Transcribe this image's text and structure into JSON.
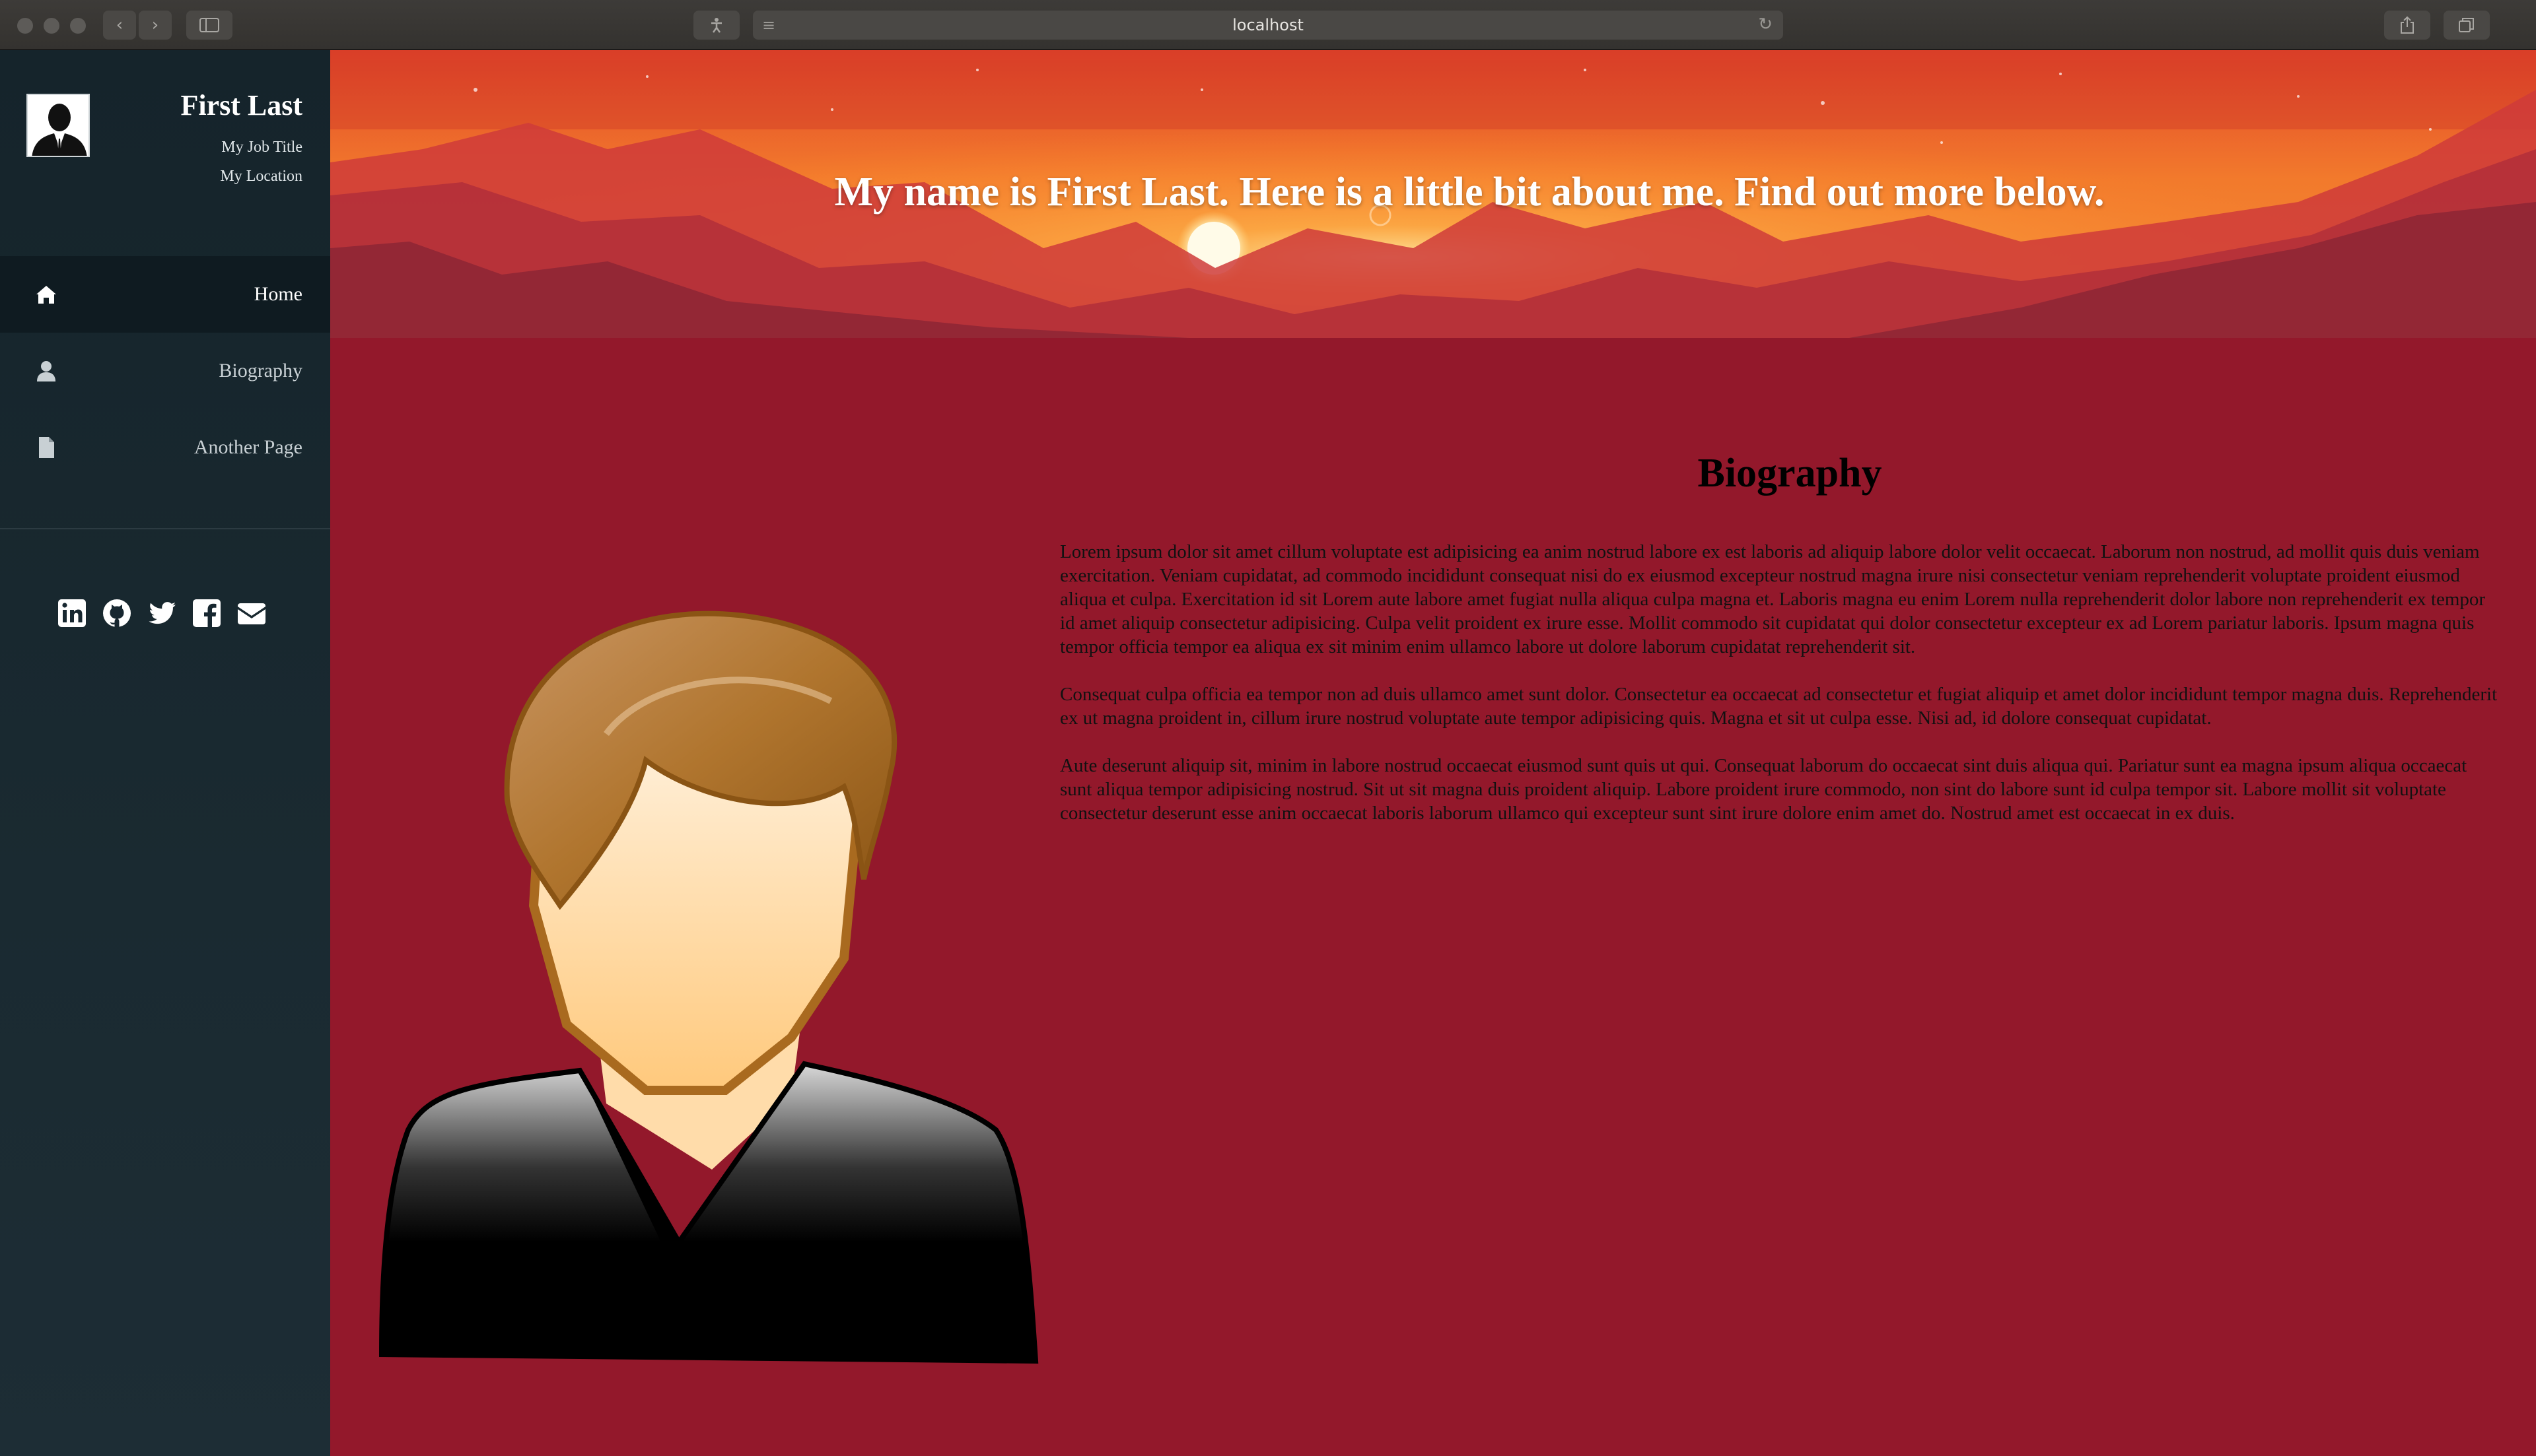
{
  "browser": {
    "url": "localhost"
  },
  "profile": {
    "name": "First Last",
    "job_title": "My Job Title",
    "location": "My Location"
  },
  "nav": {
    "items": [
      {
        "label": "Home",
        "icon": "home-icon",
        "active": true
      },
      {
        "label": "Biography",
        "icon": "user-icon",
        "active": false
      },
      {
        "label": "Another Page",
        "icon": "file-icon",
        "active": false
      }
    ]
  },
  "social": [
    "linkedin-icon",
    "github-icon",
    "twitter-icon",
    "facebook-icon",
    "envelope-icon"
  ],
  "hero": {
    "title": "My name is First Last. Here is a little bit about me. Find out more below."
  },
  "bio": {
    "heading": "Biography",
    "paragraphs": [
      "Lorem ipsum dolor sit amet cillum voluptate est adipisicing ea anim nostrud labore ex est laboris ad aliquip labore dolor velit occaecat. Laborum non nostrud, ad mollit quis duis veniam exercitation. Veniam cupidatat, ad commodo incididunt consequat nisi do ex eiusmod excepteur nostrud magna irure nisi consectetur veniam reprehenderit voluptate proident eiusmod aliqua et culpa. Exercitation id sit Lorem aute labore amet fugiat nulla aliqua culpa magna et. Laboris magna eu enim Lorem nulla reprehenderit dolor labore non reprehenderit ex tempor id amet aliquip consectetur adipisicing. Culpa velit proident ex irure esse. Mollit commodo sit cupidatat qui dolor consectetur excepteur ex ad Lorem pariatur laboris. Ipsum magna quis tempor officia tempor ea aliqua ex sit minim enim ullamco labore ut dolore laborum cupidatat reprehenderit sit.",
      "Consequat culpa officia ea tempor non ad duis ullamco amet sunt dolor. Consectetur ea occaecat ad consectetur et fugiat aliquip et amet dolor incididunt tempor magna duis. Reprehenderit ex ut magna proident in, cillum irure nostrud voluptate aute tempor adipisicing quis. Magna et sit ut culpa esse. Nisi ad, id dolore consequat cupidatat.",
      "Aute deserunt aliquip sit, minim in labore nostrud occaecat eiusmod sunt quis ut qui. Consequat laborum do occaecat sint duis aliqua qui. Pariatur sunt ea magna ipsum aliqua occaecat sunt aliqua tempor adipisicing nostrud. Sit ut sit magna duis proident aliquip. Labore proident irure commodo, non sint do labore sunt id culpa tempor sit. Labore mollit sit voluptate consectetur deserunt esse anim occaecat laboris laborum ullamco qui excepteur sunt sint irure dolore enim amet do. Nostrud amet est occaecat in ex duis."
    ]
  },
  "colors": {
    "sidebar": "#172730",
    "content_bg": "#93182b",
    "hero_sun": "#fff3c0"
  }
}
